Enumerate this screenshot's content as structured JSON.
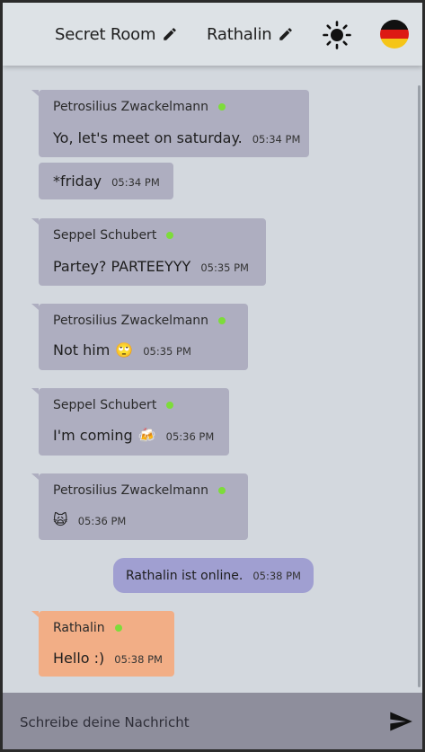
{
  "header": {
    "room_name": "Secret Room",
    "user_name": "Rathalin",
    "icons": [
      "edit-icon",
      "sun-icon",
      "german-flag-icon"
    ]
  },
  "messages": [
    {
      "sender": "Petrosilius Zwackelmann",
      "online": true,
      "text": "Yo, let's meet on saturday.",
      "time": "05:34 PM"
    },
    {
      "sender": "",
      "text": "*friday",
      "time": "05:34 PM"
    },
    {
      "sender": "Seppel Schubert",
      "online": true,
      "text": "Partey? PARTEEYYY",
      "time": "05:35 PM"
    },
    {
      "sender": "Petrosilius Zwackelmann",
      "online": true,
      "text": "Not him",
      "emoji": "🙄",
      "time": "05:35 PM"
    },
    {
      "sender": "Seppel Schubert",
      "online": true,
      "text": "I'm coming",
      "emoji": "🍻",
      "time": "05:36 PM"
    },
    {
      "sender": "Petrosilius Zwackelmann",
      "online": true,
      "text": "",
      "emoji": "🙀",
      "time": "05:36 PM"
    },
    {
      "sender": "Rathalin",
      "online": true,
      "text": "Hello :)",
      "time": "05:38 PM",
      "own": true
    }
  ],
  "system_message": {
    "text": "Rathalin ist online.",
    "time": "05:38 PM"
  },
  "composer": {
    "placeholder": "Schreibe deine Nachricht"
  },
  "colors": {
    "header_bg": "#dde2e6",
    "chat_bg": "#d3d8de",
    "bubble_other": "#aeaec0",
    "bubble_own": "#f2ae86",
    "system_bubble": "#a09fd1",
    "online_dot": "#7ddc3a",
    "composer_bg": "#8e8e9c"
  }
}
